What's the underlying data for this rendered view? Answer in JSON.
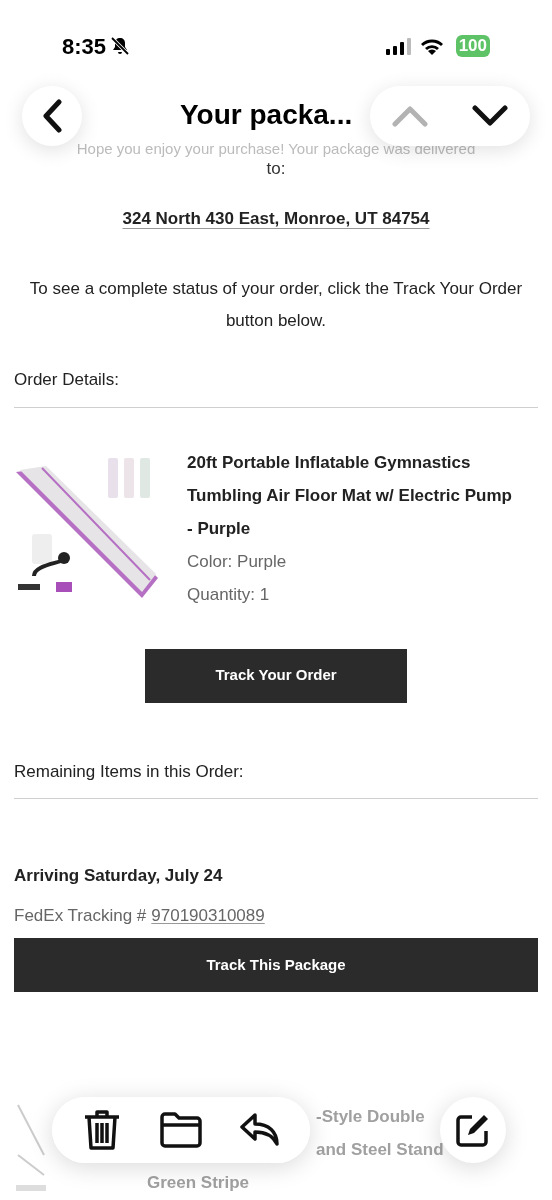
{
  "status_bar": {
    "time": "8:35",
    "silent": true,
    "battery": "100"
  },
  "nav": {
    "title": "Your packa...",
    "previous_enabled": false,
    "next_enabled": true
  },
  "email": {
    "intro": "Hope you enjoy your purchase! Your package was delivered",
    "to": "to:",
    "address": "324 North 430 East, Monroe, UT 84754",
    "instructions": "To see a complete status of your order, click the Track Your Order button below.",
    "order_details_label": "Order Details:",
    "item": {
      "title": "20ft Portable Inflatable Gymnastics Tumbling Air Floor Mat w/ Electric Pump - Purple",
      "color_text": "Color: Purple",
      "quantity": "Quantity: 1"
    },
    "track_order_button": "Track Your Order",
    "remaining_label": "Remaining Items in this Order:",
    "shipment": {
      "arrival": "Arriving Saturday, July 24",
      "tracking_label": "FedEx Tracking #",
      "tracking_number": "970190310089",
      "button": "Track This Package"
    },
    "partial_item": {
      "lines": [
        "-Style Double",
        "and Steel Stand",
        "Green Stripe"
      ]
    }
  },
  "toolbar": {
    "actions": [
      {
        "kind": "trash"
      },
      {
        "kind": "folder"
      },
      {
        "kind": "reply"
      }
    ],
    "compose": {
      "kind": "compose"
    }
  }
}
